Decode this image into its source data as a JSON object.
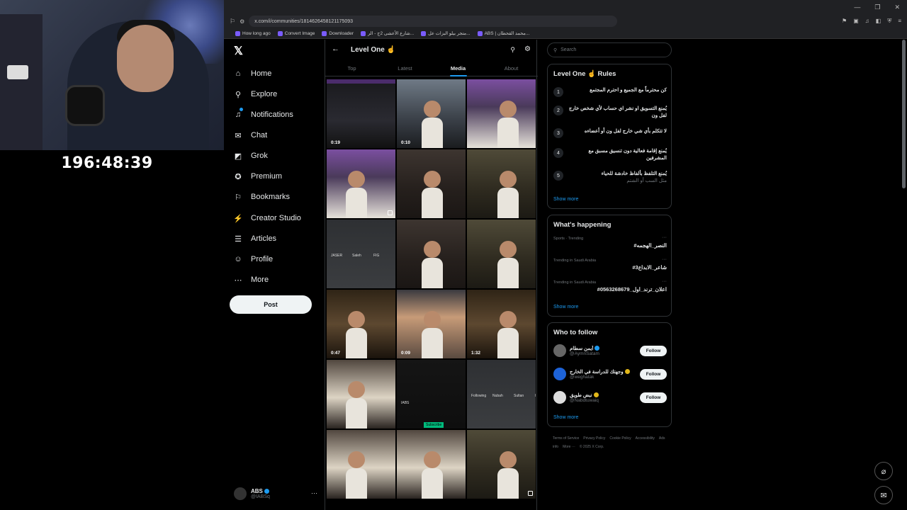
{
  "stream": {
    "timer": "196:48:39"
  },
  "browser": {
    "url": "x.com/i/communities/1814626458121175093",
    "bookmarks": [
      "How long ago",
      "Convert Image",
      "Downloader",
      "شارع الأعشى 2ج - الر...",
      "متجر بيلو البزات عل...",
      "ABS | محمد القحطان..."
    ]
  },
  "nav": {
    "logo": "𝕏",
    "items": [
      {
        "label": "Home",
        "icon": "home-icon",
        "glyph": "⌂"
      },
      {
        "label": "Explore",
        "icon": "search-icon",
        "glyph": "⚲"
      },
      {
        "label": "Notifications",
        "icon": "bell-icon",
        "glyph": "♫"
      },
      {
        "label": "Chat",
        "icon": "mail-icon",
        "glyph": "✉"
      },
      {
        "label": "Grok",
        "icon": "grok-icon",
        "glyph": "◩"
      },
      {
        "label": "Premium",
        "icon": "premium-icon",
        "glyph": "✪"
      },
      {
        "label": "Bookmarks",
        "icon": "bookmark-icon",
        "glyph": "⚐"
      },
      {
        "label": "Creator Studio",
        "icon": "creator-icon",
        "glyph": "⚡"
      },
      {
        "label": "Articles",
        "icon": "articles-icon",
        "glyph": "☰"
      },
      {
        "label": "Profile",
        "icon": "profile-icon",
        "glyph": "☺"
      },
      {
        "label": "More",
        "icon": "more-icon",
        "glyph": "⋯"
      }
    ],
    "post": "Post",
    "account": {
      "name": "ABS",
      "handle": "@IABSq"
    }
  },
  "community": {
    "title": "Level One ☝",
    "tabs": [
      "Top",
      "Latest",
      "Media",
      "About"
    ],
    "active_tab": "Media",
    "media": [
      {
        "kind": "screen",
        "duration": "0:19"
      },
      {
        "kind": "night",
        "duration": "0:10"
      },
      {
        "kind": "party",
        "duration": ""
      },
      {
        "kind": "party",
        "duration": "",
        "multi": true
      },
      {
        "kind": "studio",
        "duration": ""
      },
      {
        "kind": "outdoor",
        "duration": ""
      },
      {
        "kind": "phone",
        "duration": "",
        "labels": [
          "JASER",
          "Saleh",
          "FIG"
        ]
      },
      {
        "kind": "studio",
        "duration": ""
      },
      {
        "kind": "outdoor",
        "duration": ""
      },
      {
        "kind": "indoor",
        "duration": "0:47"
      },
      {
        "kind": "close",
        "duration": "0:09"
      },
      {
        "kind": "indoor",
        "duration": "1:32"
      },
      {
        "kind": "group",
        "duration": ""
      },
      {
        "kind": "app",
        "duration": "",
        "labels": [
          "IABS",
          "Subscribe"
        ]
      },
      {
        "kind": "phone",
        "duration": "",
        "labels": [
          "Following",
          "Nubah",
          "Sultan",
          "FIGHTER"
        ]
      },
      {
        "kind": "group",
        "duration": ""
      },
      {
        "kind": "group",
        "duration": ""
      },
      {
        "kind": "outdoor",
        "duration": "",
        "multi": true
      }
    ]
  },
  "sidebar": {
    "search_placeholder": "Search",
    "rules_title": "Level One ☝ Rules",
    "rules": [
      {
        "n": "1",
        "text": "كن محترماً مع الجميع و احترم المجتمع",
        "sub": ""
      },
      {
        "n": "2",
        "text": "يُمنع التسويق او نشر اي حساب لأي شخص خارج لفل ون",
        "sub": ""
      },
      {
        "n": "3",
        "text": "لا تتكلم بأي شي خارج لفل ون أو أعضاءه",
        "sub": ""
      },
      {
        "n": "4",
        "text": "يُمنع إقامة فعالية دون تنسيق مسبق مع المشرفين",
        "sub": ""
      },
      {
        "n": "5",
        "text": "يُمنع التلفظ بألفاظ خادشة للحياء",
        "sub": "مثل السب أو الشتم"
      }
    ],
    "show_more": "Show more",
    "happening_title": "What's happening",
    "trends": [
      {
        "category": "Sports · Trending",
        "title": "#النصر_الهجمه"
      },
      {
        "category": "Trending in Saudi Arabia",
        "title": "#شاعر_الابداع3"
      },
      {
        "category": "Trending in Saudi Arabia",
        "title": "#اعلان_ترند_اول_0563268679"
      }
    ],
    "follow_title": "Who to follow",
    "follow": [
      {
        "name": "أيمن سطام",
        "handle": "@AymnSatam",
        "badge": "blue",
        "avatar_color": "#666"
      },
      {
        "name": "وجهتك للدراسة في الخارج",
        "handle": "@weghatak",
        "badge": "gold",
        "avatar_color": "#1d63d8"
      },
      {
        "name": "نبض طويق",
        "handle": "@Nabdtuwaiq",
        "badge": "gold",
        "avatar_color": "#ddd"
      }
    ],
    "follow_label": "Follow",
    "footer": [
      "Terms of Service",
      "Privacy Policy",
      "Cookie Policy",
      "Accessibility",
      "Ads info",
      "More ···",
      "© 2025 X Corp."
    ]
  }
}
